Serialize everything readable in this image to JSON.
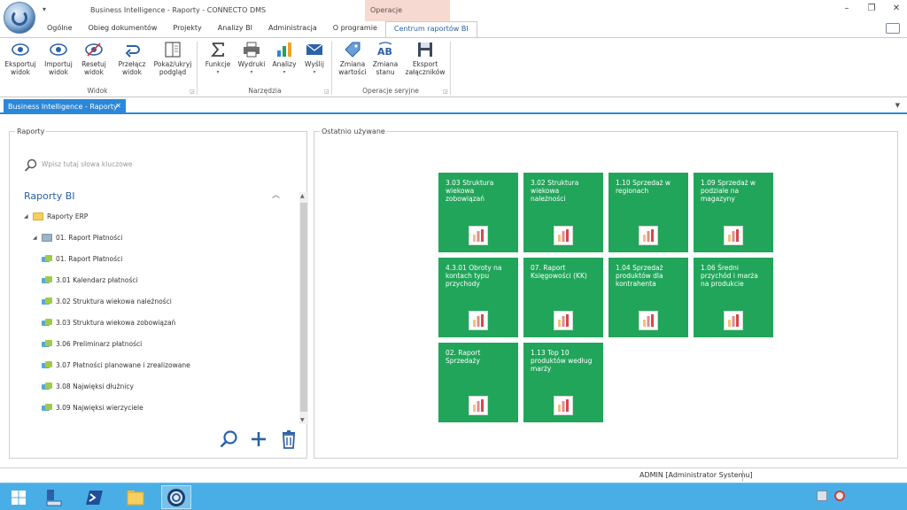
{
  "window": {
    "title": "Business Intelligence - Raporty - CONNECTO DMS",
    "qat_label": "▾",
    "context_group": "Operacje"
  },
  "ribbon_tabs": [
    "Ogólne",
    "Obieg dokumentów",
    "Projekty",
    "Analizy BI",
    "Administracja",
    "O programie",
    "Centrum raportów BI"
  ],
  "ribbon": {
    "eksportuj_l1": "Eksportuj",
    "eksportuj_l2": "widok",
    "importuj_l1": "Importuj",
    "importuj_l2": "widok",
    "resetuj_l1": "Resetuj",
    "resetuj_l2": "widok",
    "przelacz_l1": "Przełącz",
    "przelacz_l2": "widok",
    "pokaz_l1": "Pokaż/ukryj",
    "pokaz_l2": "podgląd",
    "funkcje": "Funkcje",
    "wydruki": "Wydruki",
    "analizy": "Analizy",
    "wyslij": "Wyślij",
    "zmiana_wartosci_l1": "Zmiana",
    "zmiana_wartosci_l2": "wartości",
    "zmiana_stanu_l1": "Zmiana",
    "zmiana_stanu_l2": "stanu",
    "eksport_l1": "Eksport",
    "eksport_l2": "załączników",
    "group_widok": "Widok",
    "group_narzedzia": "Narzędzia",
    "group_operacje": "Operacje seryjne"
  },
  "doc_tab": {
    "label": "Business Intelligence - Raporty",
    "close": "✕"
  },
  "reports_panel": {
    "title": "Raporty",
    "search_placeholder": "Wpisz tutaj słowa kluczowe",
    "tree_header": "Raporty BI",
    "tree": [
      "Raporty ERP",
      "01. Raport Płatności",
      "01. Raport Płatności",
      "3.01 Kalendarz płatności",
      "3.02 Struktura wiekowa należności",
      "3.03 Struktura wiekowa zobowiązań",
      "3.06 Preliminarz płatności",
      "3.07 Płatności planowane i zrealizowane",
      "3.08 Najwięksi dłużnicy",
      "3.09 Najwięksi wierzyciele"
    ]
  },
  "recent_panel": {
    "title": "Ostatnio używane",
    "tiles": [
      "3.03 Struktura wiekowa zobowiązań",
      "3.02 Struktura wiekowa należności",
      "1.10 Sprzedaż w regionach",
      "1.09 Sprzedaż w podziale na magazyny",
      "4.3.01 Obroty na kontach typu przychody",
      "07. Raport Księgowości (KK)",
      "1.04 Sprzedaż produktów dla kontrahenta",
      "1.06 Średni przychód i marża na produkcie",
      "02. Raport Sprzedaży",
      "1.13 Top 10 produktów według marży"
    ]
  },
  "status": {
    "user": "ADMIN [Administrator Systemu]"
  },
  "colors": {
    "accent": "#2b88d8",
    "tile": "#21a55a",
    "taskbar": "#4aaee6"
  }
}
